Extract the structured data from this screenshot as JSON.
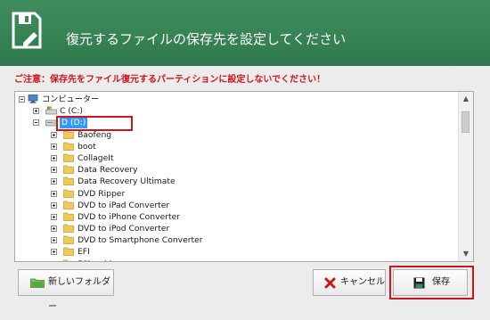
{
  "dialog": {
    "title": "復元するファイルの保存先を設定してください",
    "warning": "ご注意：保存先をファイル復元するパーティションに設定しないでください！"
  },
  "tree": {
    "root": "コンピューター",
    "drive_c": "C (C:)",
    "drive_d": "D (D:)",
    "folders": [
      "Baofeng",
      "boot",
      "CollageIt",
      "Data Recovery",
      "Data Recovery Ultimate",
      "DVD Ripper",
      "DVD to iPad Converter",
      "DVD to iPhone Converter",
      "DVD to iPod Converter",
      "DVD to Smartphone Converter",
      "EFI",
      "EShredder"
    ]
  },
  "buttons": {
    "new_folder": "新しいフォルダー",
    "cancel": "キャンセル",
    "save": "保存"
  },
  "colors": {
    "header": "#2f7a4c",
    "warning": "#d0141c",
    "highlight": "#d0141c",
    "selection": "#3399ff"
  }
}
